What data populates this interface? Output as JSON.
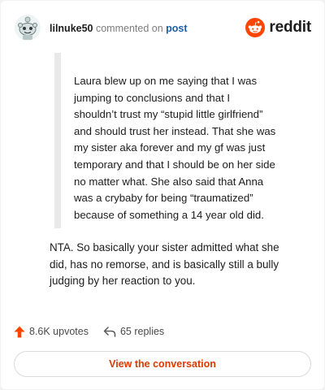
{
  "header": {
    "username": "lilnuke50",
    "action_text": "commented on",
    "post_link": "post",
    "brand": "reddit"
  },
  "comment": {
    "quote_lines": [
      "Laura blew up on me saying that I was",
      "jumping to conclusions and that I",
      "shouldn’t trust my “stupid little girlfriend”",
      "and should trust her instead. That she was",
      "my sister aka forever and my gf was just",
      "temporary and that I should be on her side",
      "no matter what. She also said that Anna",
      "was a crybaby for being “traumatized”",
      "because of something a 14 year old did."
    ],
    "body_lines": [
      "NTA. So basically your sister admitted what she",
      "did, has no remorse, and is basically still a bully",
      "judging by her reaction to you."
    ]
  },
  "stats": {
    "upvotes": "8.6K upvotes",
    "replies": "65 replies"
  },
  "cta": {
    "label": "View the conversation"
  },
  "colors": {
    "brand_orange": "#ff4500",
    "link_blue": "#1a5ea8",
    "cta_text": "#d93a00",
    "quote_bar": "#e9e9e9"
  },
  "icons": {
    "avatar": "snoo-avatar-icon",
    "brand": "reddit-logo-icon",
    "upvote": "upvote-arrow-icon",
    "reply": "reply-arrow-icon"
  }
}
